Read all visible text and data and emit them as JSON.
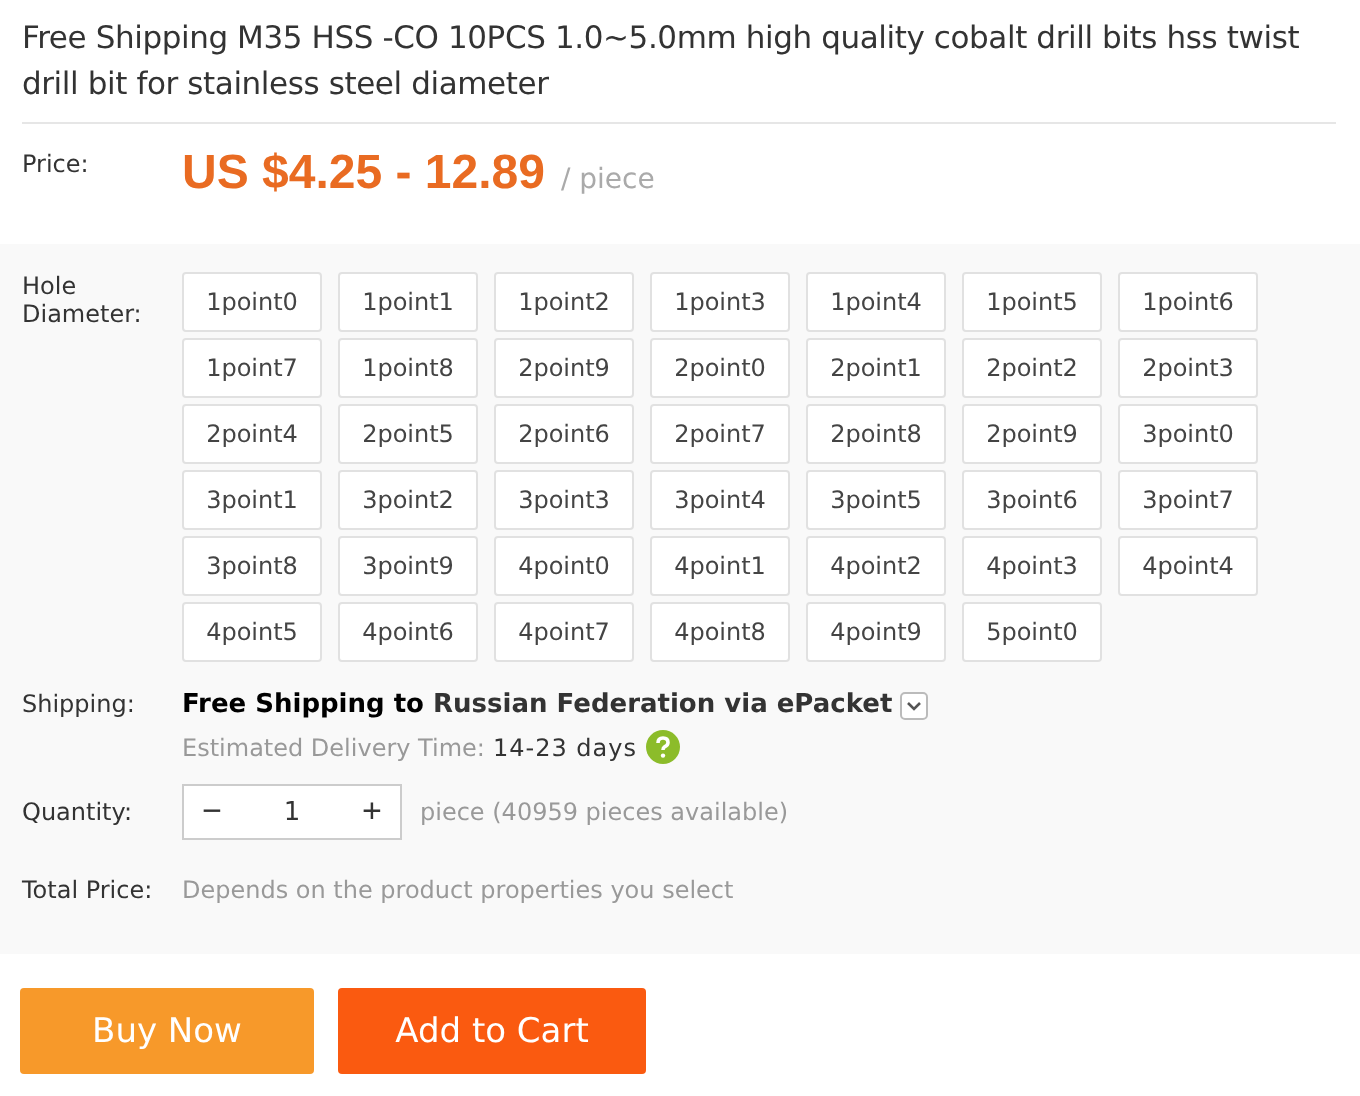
{
  "title": "Free Shipping M35 HSS -CO 10PCS 1.0~5.0mm high quality cobalt drill bits hss twist drill bit for stainless steel diameter",
  "price": {
    "label": "Price:",
    "value": "US $4.25 - 12.89",
    "unit": "/ piece"
  },
  "hole_diameter": {
    "label": "Hole Diameter:",
    "options": [
      {
        "label": "1point0",
        "selected": false
      },
      {
        "label": "1point1",
        "selected": false
      },
      {
        "label": "1point2",
        "selected": false
      },
      {
        "label": "1point3",
        "selected": false
      },
      {
        "label": "1point4",
        "selected": false
      },
      {
        "label": "1point5",
        "selected": false
      },
      {
        "label": "1point6",
        "selected": false
      },
      {
        "label": "1point7",
        "selected": false
      },
      {
        "label": "1point8",
        "selected": false
      },
      {
        "label": "2point9",
        "selected": false
      },
      {
        "label": "2point0",
        "selected": false
      },
      {
        "label": "2point1",
        "selected": false
      },
      {
        "label": "2point2",
        "selected": false
      },
      {
        "label": "2point3",
        "selected": false
      },
      {
        "label": "2point4",
        "selected": false
      },
      {
        "label": "2point5",
        "selected": false
      },
      {
        "label": "2point6",
        "selected": false
      },
      {
        "label": "2point7",
        "selected": false
      },
      {
        "label": "2point8",
        "selected": false
      },
      {
        "label": "2point9",
        "selected": false
      },
      {
        "label": "3point0",
        "selected": false
      },
      {
        "label": "3point1",
        "selected": false
      },
      {
        "label": "3point2",
        "selected": false
      },
      {
        "label": "3point3",
        "selected": false
      },
      {
        "label": "3point4",
        "selected": false
      },
      {
        "label": "3point5",
        "selected": false
      },
      {
        "label": "3point6",
        "selected": false
      },
      {
        "label": "3point7",
        "selected": false
      },
      {
        "label": "3point8",
        "selected": false
      },
      {
        "label": "3point9",
        "selected": false
      },
      {
        "label": "4point0",
        "selected": false
      },
      {
        "label": "4point1",
        "selected": false
      },
      {
        "label": "4point2",
        "selected": false
      },
      {
        "label": "4point3",
        "selected": false
      },
      {
        "label": "4point4",
        "selected": false
      },
      {
        "label": "4point5",
        "selected": false
      },
      {
        "label": "4point6",
        "selected": false
      },
      {
        "label": "4point7",
        "selected": false
      },
      {
        "label": "4point8",
        "selected": false
      },
      {
        "label": "4point9",
        "selected": false
      },
      {
        "label": "5point0",
        "selected": false
      }
    ]
  },
  "shipping": {
    "label": "Shipping:",
    "method": "**Free Shipping to** Russian Federation via ePacket",
    "delivery_label": "Estimated Delivery Time:",
    "delivery_time": "14-23 days"
  },
  "quantity": {
    "label": "Quantity:",
    "minus": "−",
    "value": "1",
    "plus": "+",
    "note": "piece (40959 pieces available)"
  },
  "total": {
    "label": "Total Price:",
    "value": "Depends on the product properties you select"
  },
  "buttons": [
    {
      "label": "Buy Now",
      "kind": "buy"
    },
    {
      "label": "Add to Cart",
      "kind": "cart"
    }
  ]
}
